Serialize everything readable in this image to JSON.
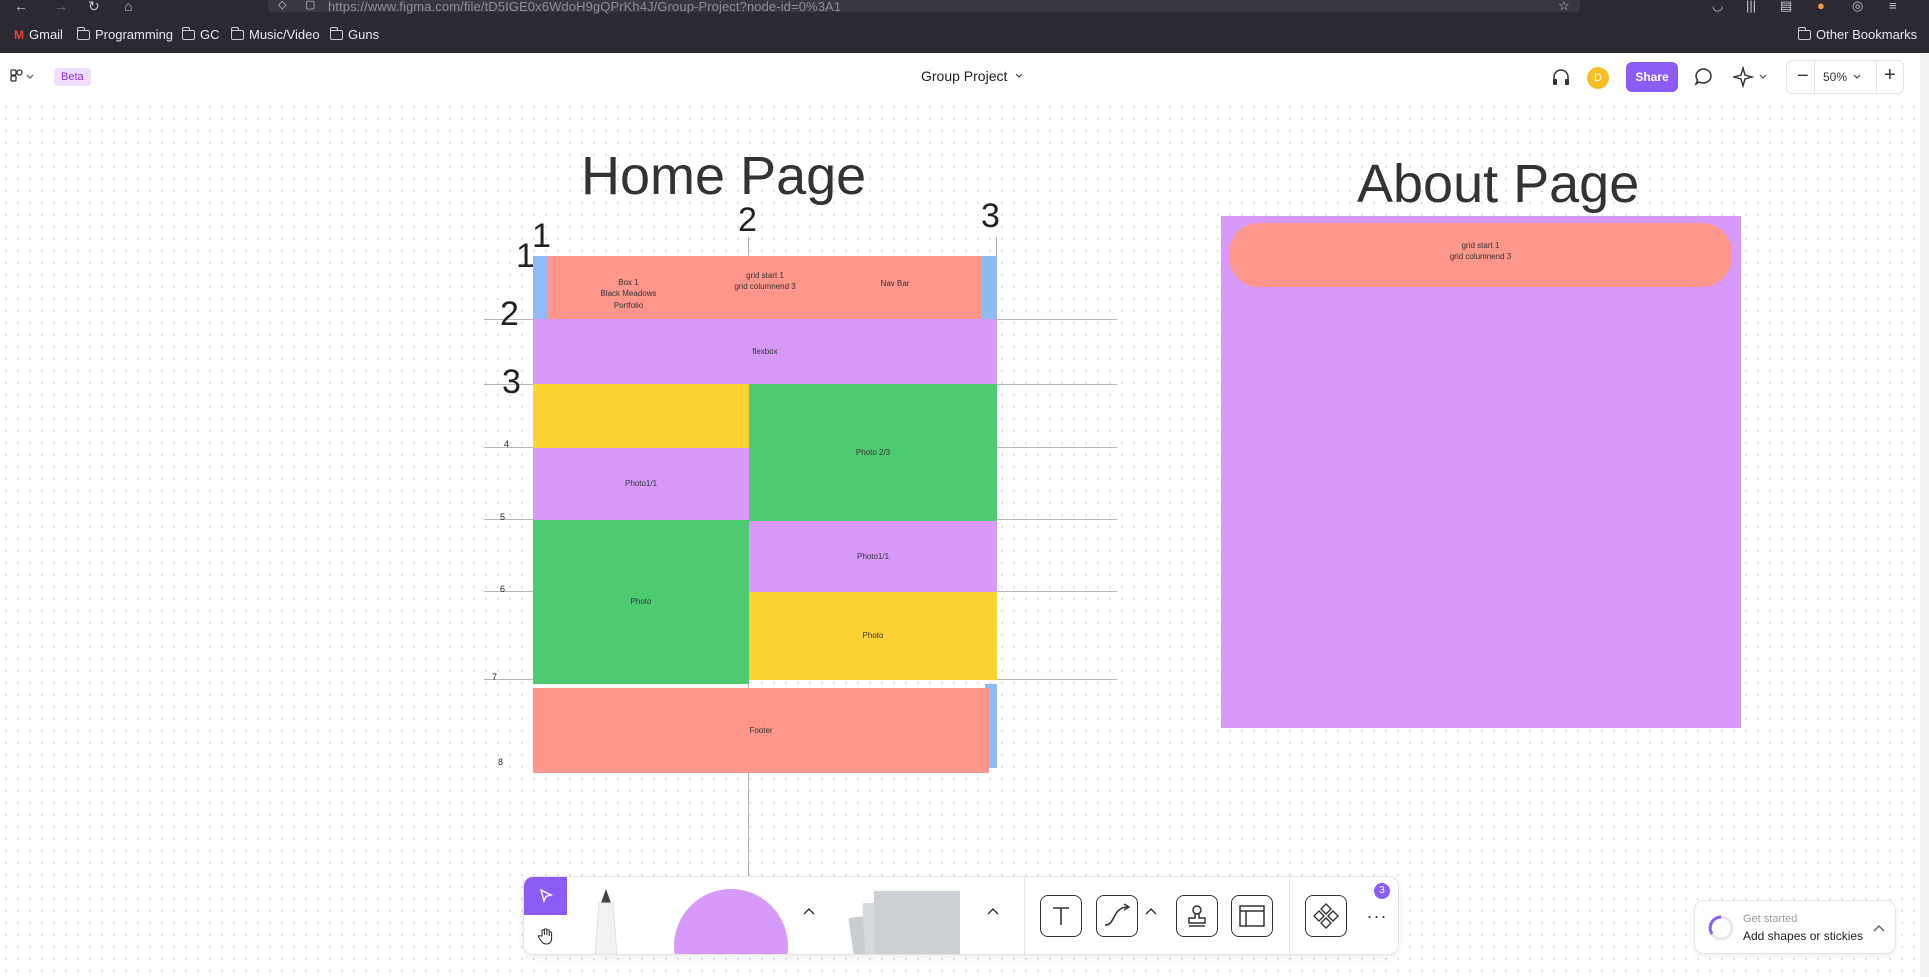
{
  "browser": {
    "url": "https://www.figma.com/file/tD5IGE0x6WdoH9gQPrKh4J/Group-Project?node-id=0%3A1",
    "bookmarks": [
      "Gmail",
      "Programming",
      "GC",
      "Music/Video",
      "Guns"
    ],
    "other_bookmarks": "Other Bookmarks"
  },
  "toolbar": {
    "beta_label": "Beta",
    "file_title": "Group Project",
    "avatar_initial": "D",
    "share_label": "Share",
    "zoom_level": "50%",
    "zoom_out_symbol": "−",
    "zoom_in_symbol": "+"
  },
  "canvas": {
    "home_page": {
      "title": "Home Page",
      "column_numbers": [
        "1",
        "2",
        "3"
      ],
      "row_numbers": [
        "1",
        "2",
        "3",
        "4",
        "5",
        "6",
        "7",
        "8"
      ],
      "cells": {
        "box1": "Box 1\nBlack Meadows\nPortfolio",
        "grid_start": "grid start 1\ngrid columnend 3",
        "nav_bar": "Nav Bar",
        "flexbox": "flexbox",
        "photo_1_1_left": "Photo1/1",
        "photo_2_3": "Photo 2/3",
        "photo_1_1_right": "Photo1/1",
        "photo_left": "Photo",
        "photo_right": "Photo",
        "footer": "Footer"
      }
    },
    "about_page": {
      "title": "About Page",
      "header_text": "grid start 1\ngrid columnend 3"
    },
    "colors": {
      "salmon": "#fd968b",
      "lavender": "#d89afa",
      "yellow": "#fdd233",
      "green": "#4ecb71",
      "blue": "#8ebbf6"
    }
  },
  "bottom_toolbar": {
    "badge_count": "3",
    "tools": [
      "move-tool",
      "hand-tool",
      "marker-tool",
      "shape-tool",
      "sticky-tool",
      "text-tool",
      "connector-tool",
      "stamp-tool",
      "section-tool",
      "components-tool",
      "more-tool"
    ]
  },
  "hint": {
    "title": "Get started",
    "subtitle": "Add shapes or stickies"
  }
}
